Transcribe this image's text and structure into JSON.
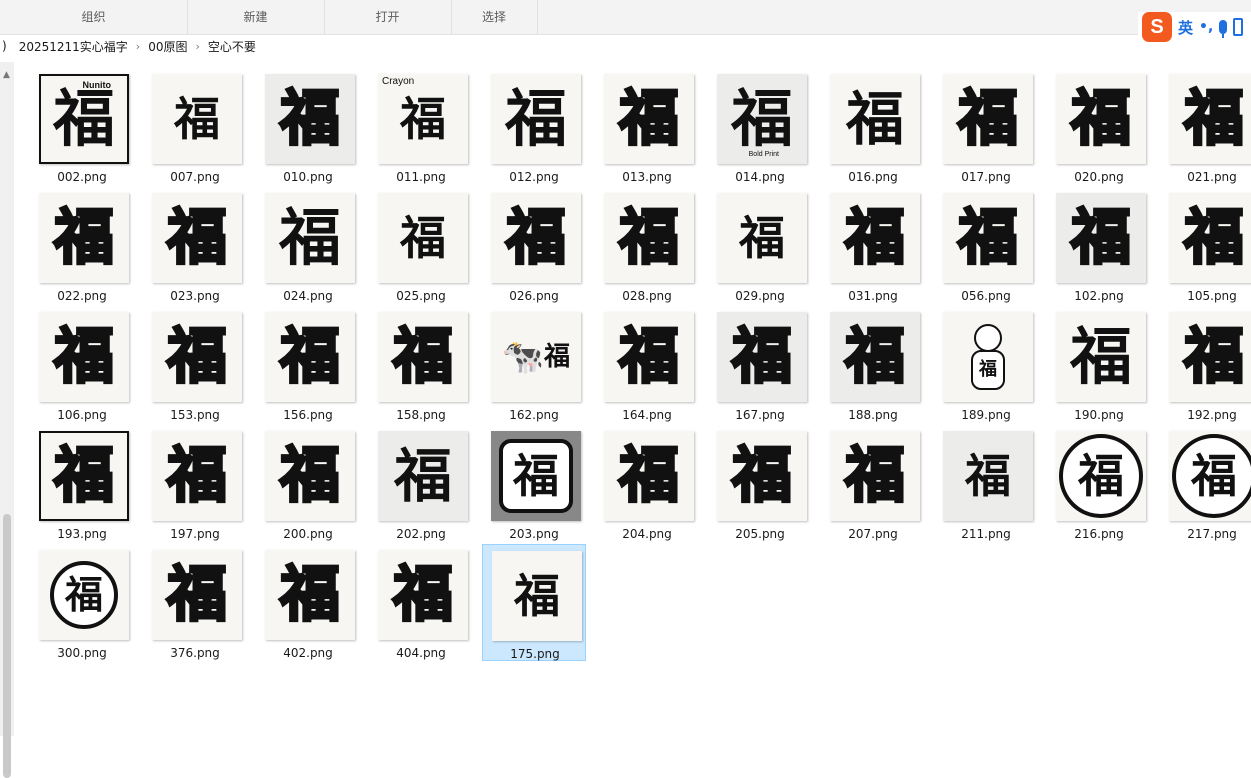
{
  "ribbon": {
    "organize": "组织",
    "new": "新建",
    "open": "打开",
    "select": "选择"
  },
  "ime": {
    "logo": "S",
    "mode": "英",
    "punct": "•,",
    "mic_icon": "mic-icon",
    "kbd_icon": "keyboard-icon"
  },
  "breadcrumb": [
    "20251211实心福字",
    "00原图",
    "空心不要"
  ],
  "breadcrumb_lead": ")",
  "glyph": "福",
  "files": [
    {
      "name": "002.png",
      "label": "Nunito",
      "style": "bold",
      "thumb": "frame"
    },
    {
      "name": "007.png",
      "style": "thin"
    },
    {
      "name": "010.png",
      "style": "outline",
      "thumb": "gray"
    },
    {
      "name": "011.png",
      "label": "Crayon",
      "style": "thin"
    },
    {
      "name": "012.png",
      "style": "bold"
    },
    {
      "name": "013.png",
      "style": "outline"
    },
    {
      "name": "014.png",
      "label": "Bold Print",
      "style": "bold",
      "thumb": "gray"
    },
    {
      "name": "016.png",
      "style": "sans"
    },
    {
      "name": "017.png",
      "style": "outline"
    },
    {
      "name": "020.png",
      "style": "outline"
    },
    {
      "name": "021.png",
      "style": "outline"
    },
    {
      "name": "022.png",
      "style": "outline"
    },
    {
      "name": "023.png",
      "style": "outline"
    },
    {
      "name": "024.png",
      "style": "bold"
    },
    {
      "name": "025.png",
      "style": "thin"
    },
    {
      "name": "026.png",
      "style": "outline"
    },
    {
      "name": "028.png",
      "style": "outline"
    },
    {
      "name": "029.png",
      "style": "thin"
    },
    {
      "name": "031.png",
      "style": "outline"
    },
    {
      "name": "056.png",
      "style": "outline"
    },
    {
      "name": "102.png",
      "style": "outline",
      "thumb": "gray"
    },
    {
      "name": "105.png",
      "style": "outline"
    },
    {
      "name": "106.png",
      "style": "outline"
    },
    {
      "name": "153.png",
      "style": "outline"
    },
    {
      "name": "156.png",
      "style": "outline"
    },
    {
      "name": "158.png",
      "style": "outline"
    },
    {
      "name": "162.png",
      "style": "cow"
    },
    {
      "name": "164.png",
      "style": "outline"
    },
    {
      "name": "167.png",
      "style": "outline",
      "thumb": "gray"
    },
    {
      "name": "188.png",
      "style": "outline",
      "thumb": "gray"
    },
    {
      "name": "189.png",
      "style": "figure"
    },
    {
      "name": "190.png",
      "style": "bold"
    },
    {
      "name": "192.png",
      "style": "outline"
    },
    {
      "name": "193.png",
      "style": "outline",
      "thumb": "frame"
    },
    {
      "name": "197.png",
      "style": "outline"
    },
    {
      "name": "200.png",
      "style": "outline"
    },
    {
      "name": "202.png",
      "style": "sans",
      "thumb": "gray"
    },
    {
      "name": "203.png",
      "style": "box",
      "thumb": "dark"
    },
    {
      "name": "204.png",
      "style": "outline"
    },
    {
      "name": "205.png",
      "style": "outline"
    },
    {
      "name": "207.png",
      "style": "outline"
    },
    {
      "name": "211.png",
      "style": "thin",
      "thumb": "gray"
    },
    {
      "name": "216.png",
      "style": "circle"
    },
    {
      "name": "217.png",
      "style": "circle"
    },
    {
      "name": "300.png",
      "style": "seal"
    },
    {
      "name": "376.png",
      "style": "outline"
    },
    {
      "name": "402.png",
      "style": "outline"
    },
    {
      "name": "404.png",
      "style": "outline"
    },
    {
      "name": "175.png",
      "style": "thin",
      "selected": true
    }
  ]
}
